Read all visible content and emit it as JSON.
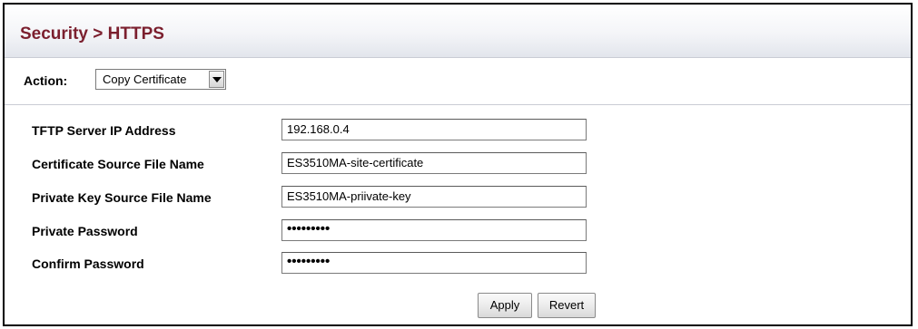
{
  "header": {
    "title": "Security > HTTPS"
  },
  "action": {
    "label": "Action:",
    "selected": "Copy Certificate"
  },
  "form": {
    "fields": [
      {
        "label": "TFTP Server IP Address",
        "value": "192.168.0.4"
      },
      {
        "label": "Certificate Source File Name",
        "value": "ES3510MA-site-certificate"
      },
      {
        "label": "Private Key Source File Name",
        "value": "ES3510MA-priivate-key"
      },
      {
        "label": "Private Password",
        "value": "•••••••••"
      },
      {
        "label": "Confirm Password",
        "value": "•••••••••"
      }
    ]
  },
  "buttons": {
    "apply": "Apply",
    "revert": "Revert"
  }
}
